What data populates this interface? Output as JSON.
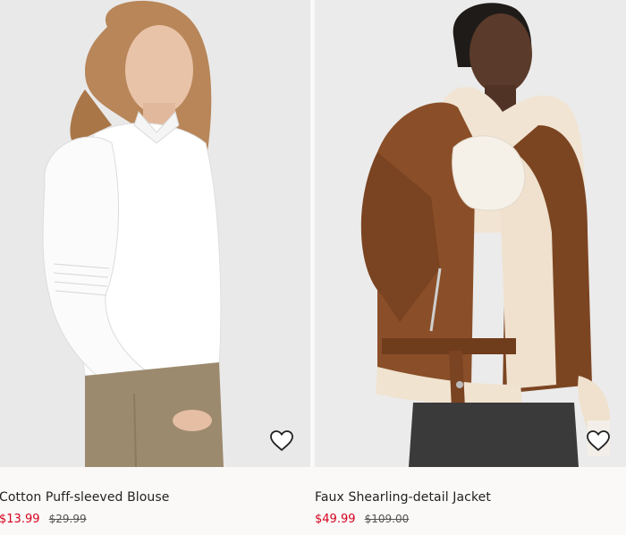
{
  "products": [
    {
      "name": "Cotton Puff-sleeved Blouse",
      "sale_price": "$13.99",
      "original_price": "$29.99"
    },
    {
      "name": "Faux Shearling-detail Jacket",
      "sale_price": "$49.99",
      "original_price": "$109.00"
    }
  ],
  "colors": {
    "sale": "#d6001c",
    "text": "#222222",
    "background": "#faf9f8"
  },
  "icons": [
    "heart-outline-icon"
  ]
}
